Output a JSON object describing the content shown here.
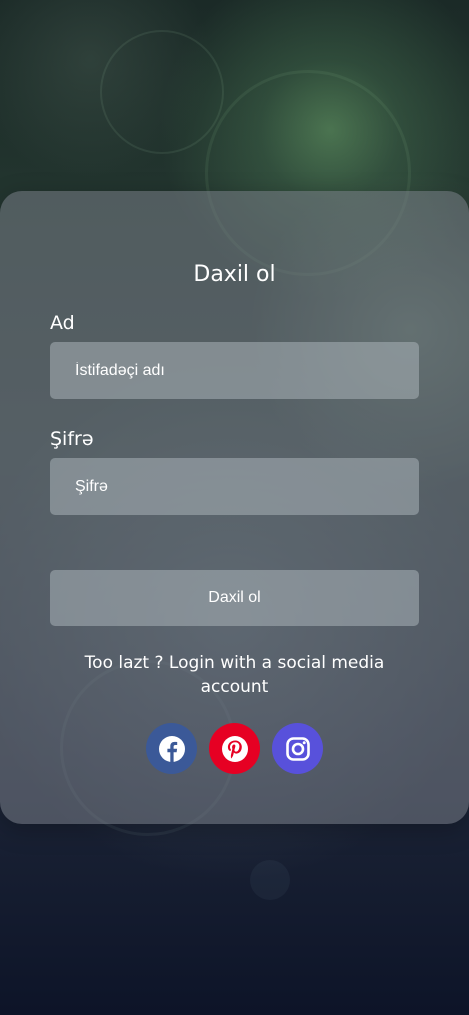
{
  "login": {
    "title": "Daxil ol",
    "username_label": "Ad",
    "username_placeholder": "İstifadəçi adı",
    "password_label": "Şifrə",
    "password_placeholder": "Şifrə",
    "submit_label": "Daxil ol",
    "social_prompt": "Too lazt ? Login with a social media account"
  },
  "social": [
    {
      "name": "facebook",
      "icon": "facebook-icon",
      "color": "#3b5998"
    },
    {
      "name": "pinterest",
      "icon": "pinterest-icon",
      "color": "#e60023"
    },
    {
      "name": "instagram",
      "icon": "instagram-icon",
      "color": "#5851db"
    }
  ]
}
